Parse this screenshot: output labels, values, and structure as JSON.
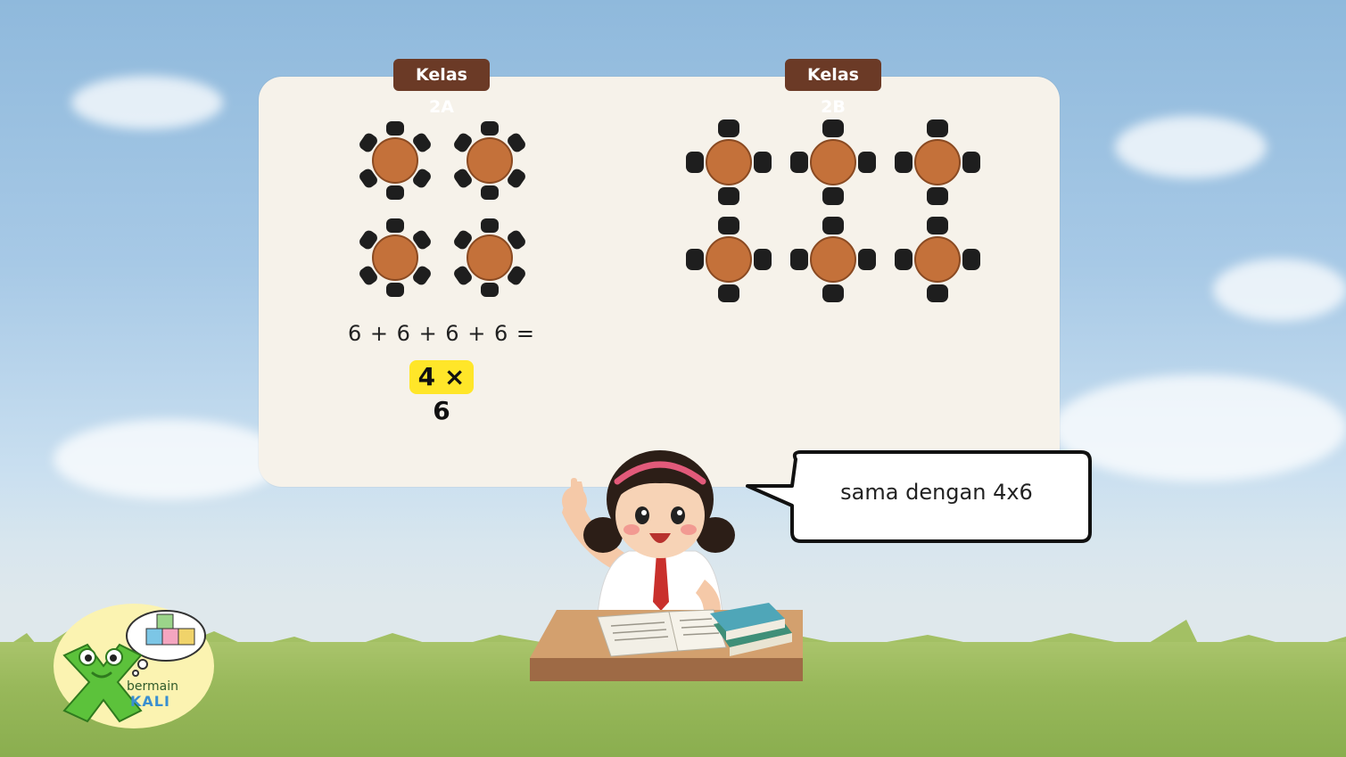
{
  "slide": {
    "class_a_label": "Kelas 2A",
    "class_b_label": "Kelas 2B",
    "equation": "6 + 6 + 6 + 6 = ...",
    "multiplication": "4 × 6",
    "speech": "sama dengan 4x6"
  },
  "logo": {
    "line1": "bermain",
    "line2": "KALI"
  },
  "icons": {
    "table_a": "round-table-six-chairs-icon",
    "table_b": "round-table-four-chairs-icon",
    "girl": "student-girl-illustration",
    "mascot": "green-x-mascot-icon",
    "blocks": "number-blocks-thought-icon"
  },
  "colors": {
    "tag_bg": "#6b3a26",
    "table_wood": "#c4713a",
    "chair": "#1e1e1e",
    "highlight": "#ffe629",
    "board": "#f6f2ea"
  }
}
